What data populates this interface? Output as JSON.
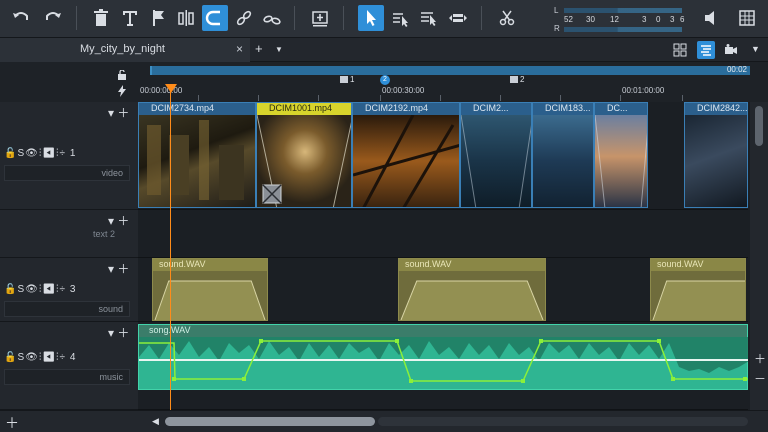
{
  "toolbar": {
    "buttons": [
      "undo",
      "redo",
      "delete",
      "text",
      "marker",
      "split",
      "magnet",
      "link",
      "unlink",
      "insert-mode",
      "select-tool",
      "range-tool-1",
      "range-tool-2",
      "stretch-tool",
      "cut-tool",
      "volume",
      "grid"
    ]
  },
  "vu_meter": {
    "left_label": "L",
    "right_label": "R",
    "scale": [
      "52",
      "30",
      "12",
      "3",
      "0",
      "3",
      "6"
    ]
  },
  "tabs": {
    "project_name": "My_city_by_night",
    "close_symbol": "×",
    "add_symbol": "+",
    "dropdown_symbol": "▼"
  },
  "ruler": {
    "range_end": "00:02",
    "markers": [
      {
        "label": "1",
        "kind": "flag"
      },
      {
        "label": "2",
        "kind": "chapter"
      },
      {
        "label": "2",
        "kind": "flag"
      }
    ],
    "timecodes": [
      "00:00:00:00",
      "00:00:30:00",
      "00:01:00:00"
    ]
  },
  "tracks": [
    {
      "number": "1",
      "name": "video",
      "icons": "🔓S👁⫶◀ ⫶ ÷"
    },
    {
      "number": "2",
      "name": "text"
    },
    {
      "number": "3",
      "name": "sound",
      "icons": "🔓S👁⫶◀ ⫶ ÷"
    },
    {
      "number": "4",
      "name": "music",
      "icons": "🔓S👁⫶◀ ⫶ ÷"
    }
  ],
  "video_clips": [
    {
      "label": "DCIM2734.mp4",
      "selected": false
    },
    {
      "label": "DCIM1001.mp4",
      "selected": true
    },
    {
      "label": "DCIM2192.mp4",
      "selected": false
    },
    {
      "label": "DCIM2...",
      "selected": false
    },
    {
      "label": "DCIM183...",
      "selected": false
    },
    {
      "label": "DC...",
      "selected": false
    },
    {
      "label": "DCIM2842...",
      "selected": false
    }
  ],
  "sound_clips": [
    {
      "label": "sound.WAV"
    },
    {
      "label": "sound.WAV"
    },
    {
      "label": "sound.WAV"
    }
  ],
  "music_clip": {
    "label": "song.WAV"
  },
  "colors": {
    "accent": "#2f8fd8",
    "playhead": "#ff8c1a",
    "selected_clip": "#d8d42c",
    "audio_clip": "#6f6c3c",
    "music_clip": "#2fb592",
    "envelope": "#8bf03a"
  }
}
